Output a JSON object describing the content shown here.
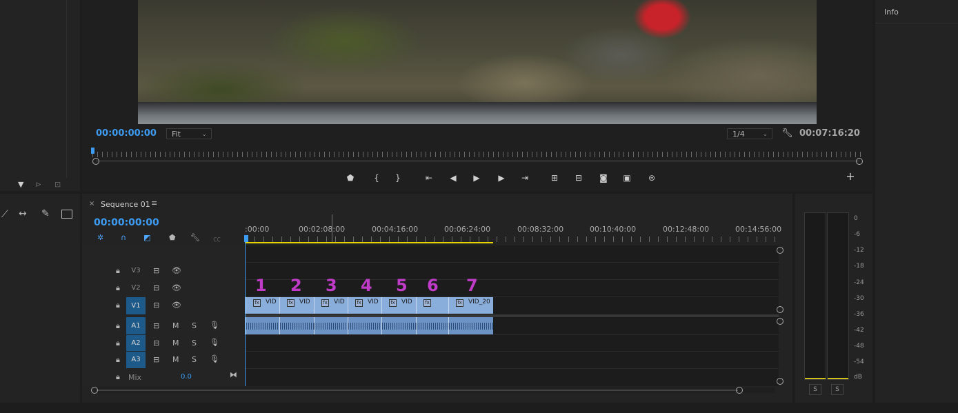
{
  "program_monitor": {
    "timecode_current": "00:00:00:00",
    "zoom_value": "Fit",
    "resolution_value": "1/4",
    "timecode_duration": "00:07:16:20"
  },
  "info_panel": {
    "title": "Info"
  },
  "timeline": {
    "tab_title": "Sequence 01",
    "timecode": "00:00:00:00",
    "ruler_labels": [
      ":00:00",
      "00:02:08:00",
      "00:04:16:00",
      "00:06:24:00",
      "00:08:32:00",
      "00:10:40:00",
      "00:12:48:00",
      "00:14:56:00"
    ],
    "tracks": {
      "v3": "V3",
      "v2": "V2",
      "v1": "V1",
      "a1": "A1",
      "a2": "A2",
      "a3": "A3",
      "mix": "Mix",
      "mix_value": "0.0"
    },
    "mute_label": "M",
    "solo_label": "S",
    "clip_names": [
      "VID",
      "VID",
      "VID",
      "VID",
      "VID",
      "",
      "VID_20"
    ],
    "annotations": [
      "1",
      "2",
      "3",
      "4",
      "5",
      "6",
      "7"
    ]
  },
  "audio_meter": {
    "scale": [
      "0",
      "-6",
      "-12",
      "-18",
      "-24",
      "-30",
      "-36",
      "-42",
      "-48",
      "-54",
      "dB"
    ],
    "solo_left": "S",
    "solo_right": "S"
  },
  "colors": {
    "accent_blue": "#3d9bf2",
    "clip_video": "#8aaedc",
    "clip_audio": "#6d92c4",
    "annotation": "#c03cc8",
    "work_area": "#e6d400"
  }
}
